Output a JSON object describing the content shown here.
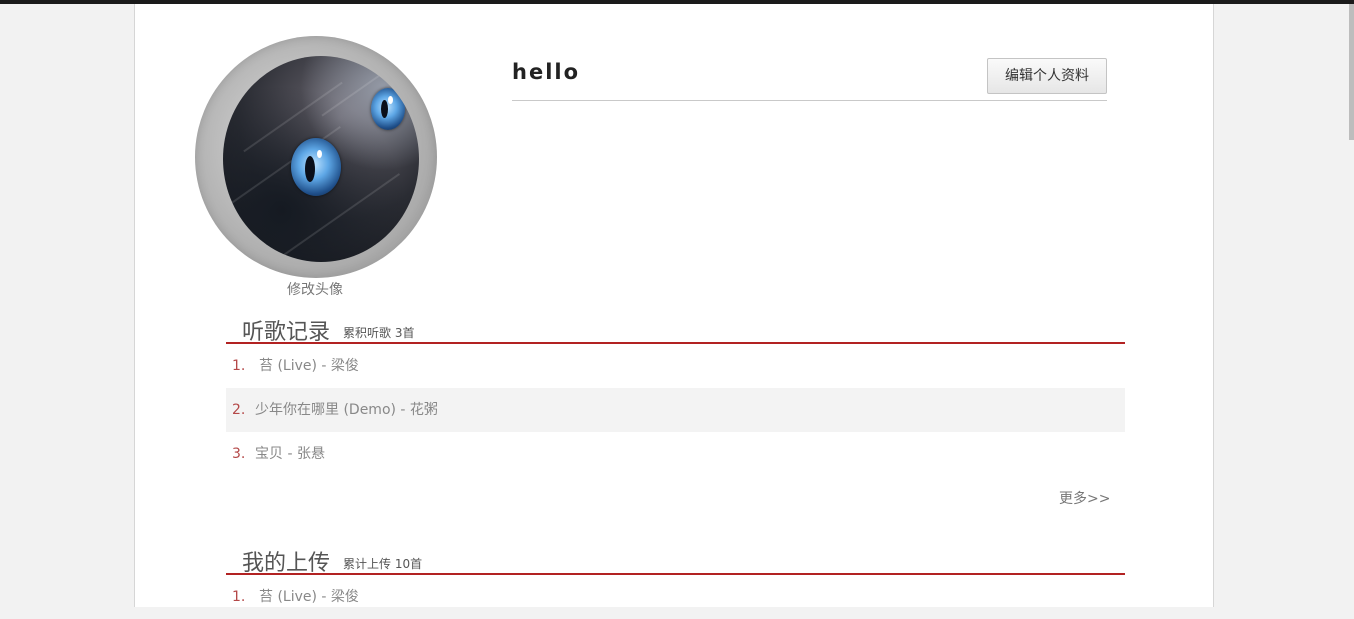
{
  "profile": {
    "username": "hello",
    "change_avatar_label": "修改头像",
    "edit_profile_label": "编辑个人资料"
  },
  "listen_history": {
    "title": "听歌记录",
    "count_text": "累积听歌 3首",
    "items": [
      {
        "num": "1.",
        "text": "苔 (Live) - 梁俊"
      },
      {
        "num": "2.",
        "text": "少年你在哪里 (Demo) - 花粥"
      },
      {
        "num": "3.",
        "text": "宝贝 - 张悬"
      }
    ],
    "more_label": "更多>>"
  },
  "uploads": {
    "title": "我的上传",
    "count_text": "累计上传 10首",
    "items": [
      {
        "num": "1.",
        "text": "苔 (Live) - 梁俊"
      }
    ]
  },
  "colors": {
    "accent_red": "#b22222",
    "page_bg": "#f2f2f2",
    "panel_bg": "#ffffff"
  }
}
